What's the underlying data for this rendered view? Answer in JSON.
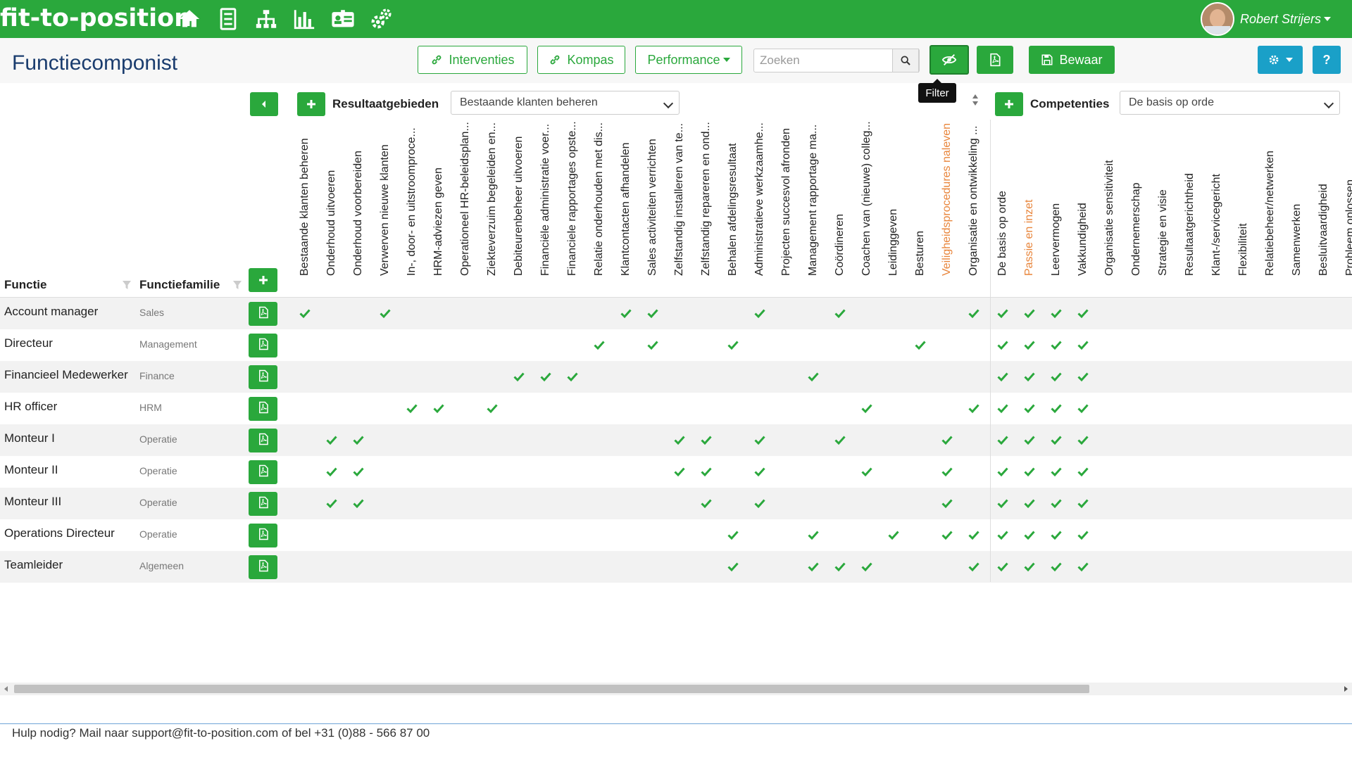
{
  "app": {
    "logo": "fit-to-position"
  },
  "nav": {
    "icons": [
      "home-icon",
      "checklist-icon",
      "org-chart-icon",
      "bar-chart-icon",
      "id-card-icon",
      "cogs-icon"
    ]
  },
  "user": {
    "name": "Robert Strijers"
  },
  "page": {
    "title": "Functiecomponist"
  },
  "toolbar": {
    "interventies_label": "Interventies",
    "kompas_label": "Kompas",
    "performance_label": "Performance",
    "search_placeholder": "Zoeken",
    "save_label": "Bewaar",
    "filter_tooltip": "Filter"
  },
  "colors": {
    "brand": "#2aa83c",
    "accent_orange": "#e8853b",
    "title_blue": "#1a3c6e",
    "teal": "#1aa0c8"
  },
  "resultaat": {
    "label": "Resultaatgebieden",
    "selected": "Bestaande klanten beheren",
    "columns": [
      "Bestaande klanten beheren",
      "Onderhoud uitvoeren",
      "Onderhoud voorbereiden",
      "Verwerven nieuwe klanten",
      "In-, door- en uitstroomproce...",
      "HRM-adviezen geven",
      "Operationeel HR-beleidsplan...",
      "Ziekteverzuim begeleiden en...",
      "Debiteurenbeheer uitvoeren",
      "Financiële administratie voer...",
      "Financiele rapportages opste...",
      "Relatie onderhouden met dis...",
      "Klantcontacten afhandelen",
      "Sales activiteiten verrichten",
      "Zelfstandig installeren van te...",
      "Zelfstandig repareren en ond...",
      "Behalen afdelingsresultaat",
      "Administratieve werkzaamhe...",
      "Projecten succesvol afronden",
      "Management rapportage ma...",
      "Coördineren",
      "Coachen van (nieuwe) colleg...",
      "Leidinggeven",
      "Besturen",
      "Veiligheidsprocedures naleven",
      "Organisatie en ontwikkeling ..."
    ],
    "highlight_index": 24
  },
  "competenties": {
    "label": "Competenties",
    "selected": "De basis op orde",
    "columns": [
      "De basis op orde",
      "Passie en inzet",
      "Leervermogen",
      "Vakkundigheid",
      "Organisatie sensitiviteit",
      "Ondernemerschap",
      "Strategie en visie",
      "Resultaatgerichtheid",
      "Klant-/servicegericht",
      "Flexibiliteit",
      "Relatiebeheer/netwerken",
      "Samenwerken",
      "Besluitvaardigheid",
      "Probleem oplossen"
    ],
    "highlight_index": 1
  },
  "table": {
    "col_functie": "Functie",
    "col_familie": "Functiefamilie",
    "rows": [
      {
        "name": "Account manager",
        "family": "Sales",
        "res": [
          0,
          3,
          12,
          13,
          17,
          20,
          25
        ],
        "comp": [
          0,
          1,
          2,
          3
        ]
      },
      {
        "name": "Directeur",
        "family": "Management",
        "res": [
          11,
          13,
          16,
          23
        ],
        "comp": [
          0,
          1,
          2,
          3
        ]
      },
      {
        "name": "Financieel Medewerker",
        "family": "Finance",
        "res": [
          8,
          9,
          10,
          19
        ],
        "comp": [
          0,
          1,
          2,
          3
        ]
      },
      {
        "name": "HR officer",
        "family": "HRM",
        "res": [
          4,
          5,
          7,
          21,
          25
        ],
        "comp": [
          0,
          1,
          2,
          3
        ]
      },
      {
        "name": "Monteur I",
        "family": "Operatie",
        "res": [
          1,
          2,
          14,
          15,
          17,
          20,
          24
        ],
        "comp": [
          0,
          1,
          2,
          3
        ]
      },
      {
        "name": "Monteur II",
        "family": "Operatie",
        "res": [
          1,
          2,
          14,
          15,
          17,
          21,
          24
        ],
        "comp": [
          0,
          1,
          2,
          3
        ]
      },
      {
        "name": "Monteur III",
        "family": "Operatie",
        "res": [
          1,
          2,
          15,
          17,
          24
        ],
        "comp": [
          0,
          1,
          2,
          3
        ]
      },
      {
        "name": "Operations Directeur",
        "family": "Operatie",
        "res": [
          16,
          19,
          22,
          24,
          25
        ],
        "comp": [
          0,
          1,
          2,
          3
        ]
      },
      {
        "name": "Teamleider",
        "family": "Algemeen",
        "res": [
          16,
          19,
          20,
          21,
          25
        ],
        "comp": [
          0,
          1,
          2,
          3
        ]
      }
    ]
  },
  "footer": {
    "text": "Hulp nodig? Mail naar support@fit-to-position.com of bel +31 (0)88 - 566 87 00"
  }
}
